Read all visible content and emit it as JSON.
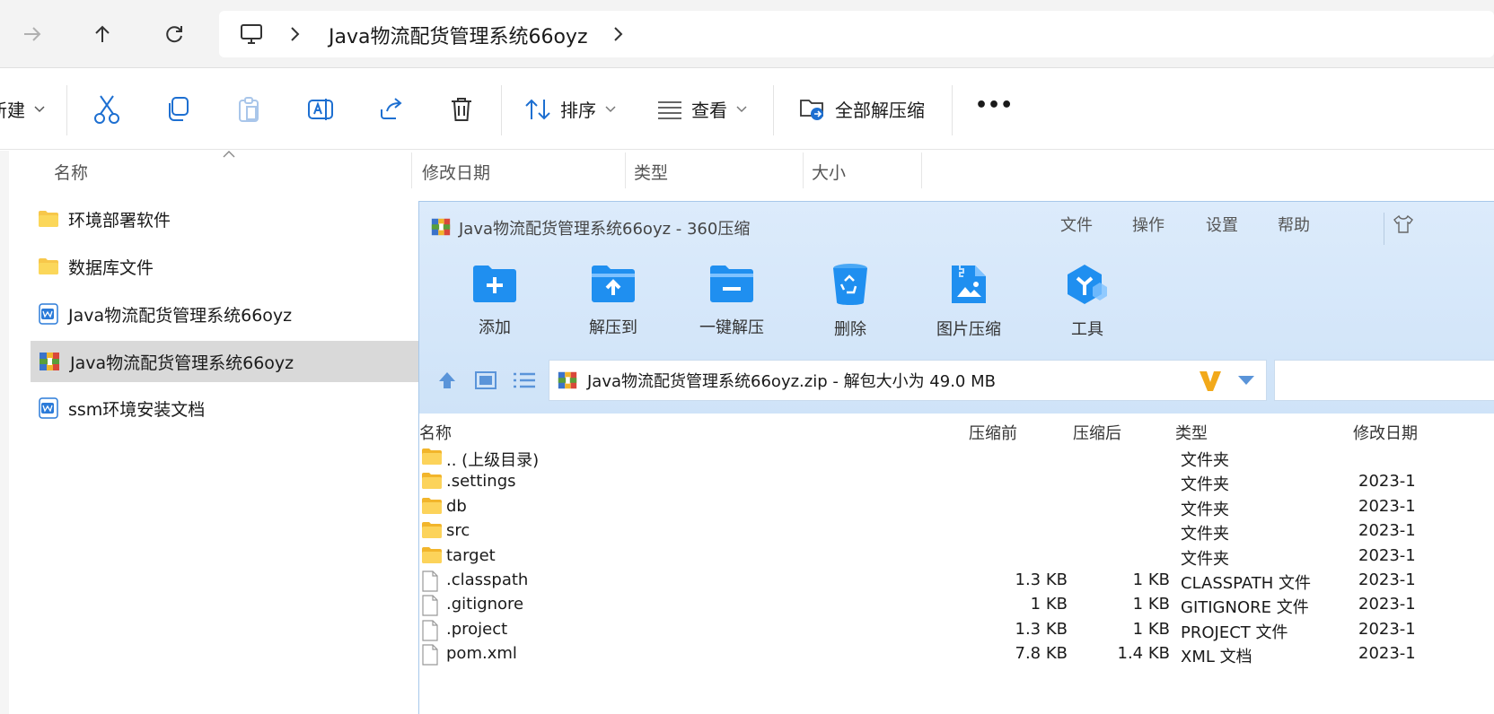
{
  "address": {
    "path": "Java物流配货管理系统66oyz"
  },
  "toolbar": {
    "new_label": "新建",
    "sort_label": "排序",
    "view_label": "查看",
    "extract_all_label": "全部解压缩",
    "more_label": "•••"
  },
  "explorer": {
    "columns": {
      "name": "名称",
      "modified": "修改日期",
      "type": "类型",
      "size": "大小"
    },
    "files": [
      {
        "name": "环境部署软件",
        "icon": "folder-icon"
      },
      {
        "name": "数据库文件",
        "icon": "folder-icon"
      },
      {
        "name": "Java物流配货管理系统66oyz",
        "icon": "word-doc-icon"
      },
      {
        "name": "Java物流配货管理系统66oyz",
        "icon": "zip-archive-icon"
      },
      {
        "name": "ssm环境安装文档",
        "icon": "word-doc-icon"
      }
    ]
  },
  "zip": {
    "title": "Java物流配货管理系统66oyz - 360压缩",
    "menu": [
      "文件",
      "操作",
      "设置",
      "帮助"
    ],
    "buttons": [
      "添加",
      "解压到",
      "一键解压",
      "删除",
      "图片压缩",
      "工具"
    ],
    "path": "Java物流配货管理系统66oyz.zip - 解包大小为 49.0 MB",
    "columns": {
      "name": "名称",
      "before": "压缩前",
      "after": "压缩后",
      "type": "类型",
      "modified": "修改日期"
    },
    "rows": [
      {
        "name": ".. (上级目录)",
        "before": "",
        "after": "",
        "type": "文件夹",
        "modified": "",
        "icon": "folder"
      },
      {
        "name": ".settings",
        "before": "",
        "after": "",
        "type": "文件夹",
        "modified": "2023-1",
        "icon": "folder"
      },
      {
        "name": "db",
        "before": "",
        "after": "",
        "type": "文件夹",
        "modified": "2023-1",
        "icon": "folder"
      },
      {
        "name": "src",
        "before": "",
        "after": "",
        "type": "文件夹",
        "modified": "2023-1",
        "icon": "folder"
      },
      {
        "name": "target",
        "before": "",
        "after": "",
        "type": "文件夹",
        "modified": "2023-1",
        "icon": "folder"
      },
      {
        "name": ".classpath",
        "before": "1.3 KB",
        "after": "1 KB",
        "type": "CLASSPATH 文件",
        "modified": "2023-1",
        "icon": "file"
      },
      {
        "name": ".gitignore",
        "before": "1 KB",
        "after": "1 KB",
        "type": "GITIGNORE 文件",
        "modified": "2023-1",
        "icon": "file"
      },
      {
        "name": ".project",
        "before": "1.3 KB",
        "after": "1 KB",
        "type": "PROJECT 文件",
        "modified": "2023-1",
        "icon": "file"
      },
      {
        "name": "pom.xml",
        "before": "7.8 KB",
        "after": "1.4 KB",
        "type": "XML 文档",
        "modified": "2023-1",
        "icon": "file"
      }
    ]
  }
}
